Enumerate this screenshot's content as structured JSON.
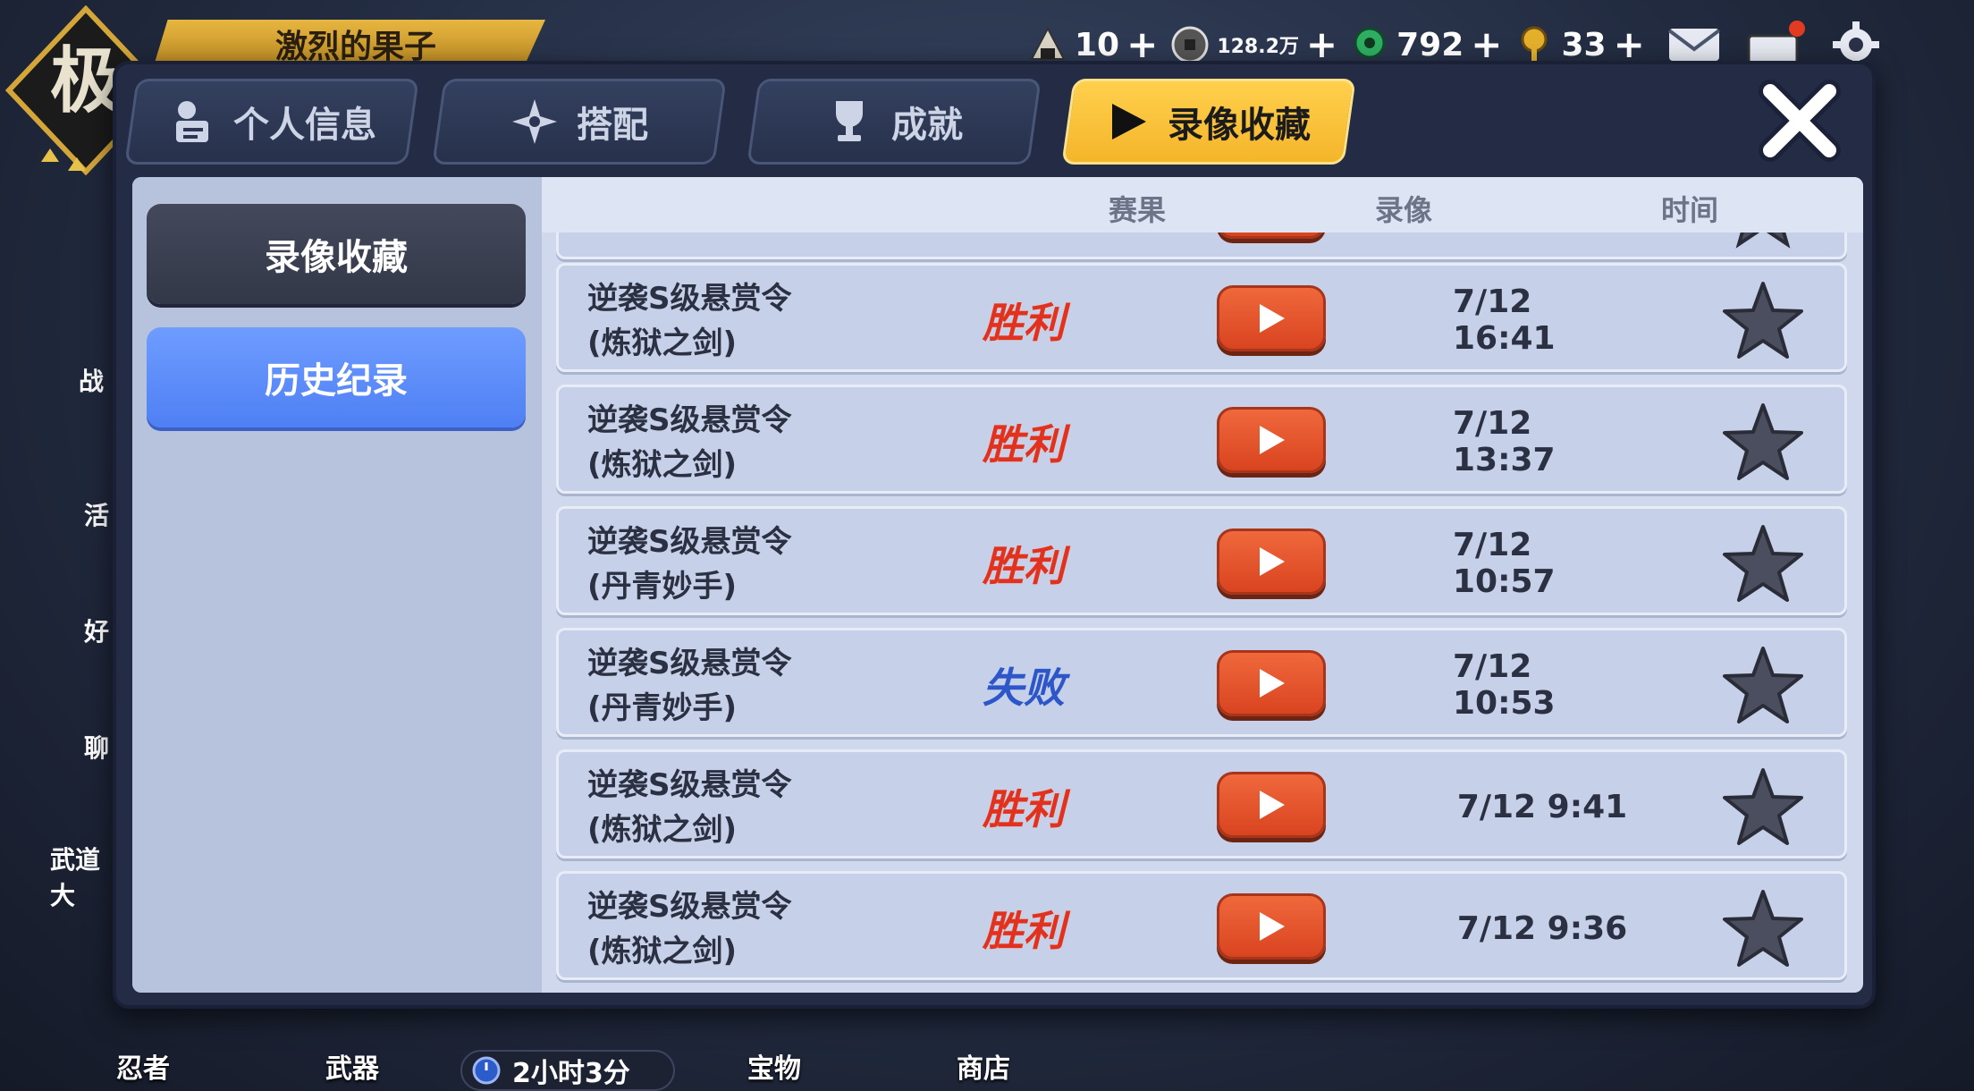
{
  "hud": {
    "rank_char": "极",
    "player_name": "激烈的果子",
    "currencies": [
      {
        "icon": "rice-ball-icon",
        "value": "10"
      },
      {
        "icon": "coin-icon",
        "value": "128.2万"
      },
      {
        "icon": "green-gem-icon",
        "value": "792"
      },
      {
        "icon": "gold-key-icon",
        "value": "33"
      }
    ],
    "left_menu": [
      "战",
      "活",
      "好",
      "聊",
      "武道大"
    ],
    "bottom_nav": [
      "忍者",
      "武器",
      "宝物",
      "商店"
    ],
    "timer": "2小时3分"
  },
  "tabs": [
    {
      "label": "个人信息",
      "icon": "profile-icon"
    },
    {
      "label": "搭配",
      "icon": "shuriken-icon"
    },
    {
      "label": "成就",
      "icon": "trophy-icon"
    },
    {
      "label": "录像收藏",
      "icon": "play-icon",
      "active": true
    }
  ],
  "sidebar": [
    {
      "label": "录像收藏"
    },
    {
      "label": "历史纪录",
      "selected": true
    }
  ],
  "table": {
    "headers": {
      "result": "赛果",
      "video": "录像",
      "time": "时间"
    },
    "rows": [
      {
        "title": "逆袭S级悬赏令\n(炼狱之剑)",
        "result": "胜利",
        "win": true,
        "time": "7/12 16:41"
      },
      {
        "title": "逆袭S级悬赏令\n(炼狱之剑)",
        "result": "胜利",
        "win": true,
        "time": "7/12 13:37"
      },
      {
        "title": "逆袭S级悬赏令\n(丹青妙手)",
        "result": "胜利",
        "win": true,
        "time": "7/12 10:57"
      },
      {
        "title": "逆袭S级悬赏令\n(丹青妙手)",
        "result": "失败",
        "win": false,
        "time": "7/12 10:53"
      },
      {
        "title": "逆袭S级悬赏令\n(炼狱之剑)",
        "result": "胜利",
        "win": true,
        "time": "7/12 9:41"
      },
      {
        "title": "逆袭S级悬赏令\n(炼狱之剑)",
        "result": "胜利",
        "win": true,
        "time": "7/12 9:36"
      }
    ]
  },
  "colors": {
    "win": "#e0321e",
    "lose": "#2d56c8",
    "accent": "#f4b52a",
    "selected": "#5a8bf8"
  }
}
